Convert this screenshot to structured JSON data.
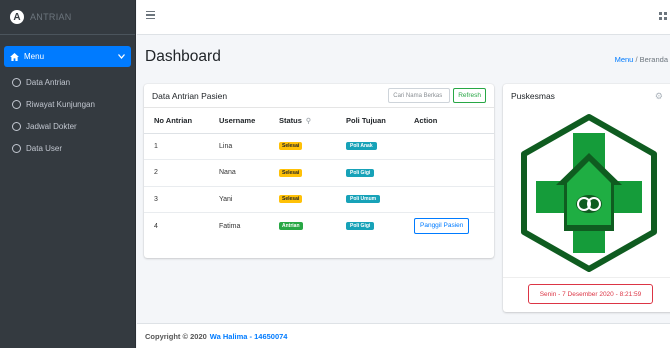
{
  "brand": {
    "name": "ANTRIAN"
  },
  "sidebar": {
    "menu_label": "Menu",
    "items": [
      {
        "label": "Data Antrian"
      },
      {
        "label": "Riwayat Kunjungan"
      },
      {
        "label": "Jadwal Dokter"
      },
      {
        "label": "Data User"
      }
    ]
  },
  "header": {
    "title": "Dashboard",
    "breadcrumb": {
      "first": "Menu",
      "sep": "/",
      "second": "Beranda"
    }
  },
  "queue_card": {
    "title": "Data Antrian Pasien",
    "search_placeholder": "Cari Nama Berkas",
    "refresh_label": "Refresh",
    "columns": [
      "No Antrian",
      "Username",
      "Status",
      "Poli Tujuan",
      "Action"
    ],
    "rows": [
      {
        "no": "1",
        "username": "Lina",
        "status": "Selesai",
        "poli": "Poli Anak",
        "action": ""
      },
      {
        "no": "2",
        "username": "Nana",
        "status": "Selesai",
        "poli": "Poli Gigi",
        "action": ""
      },
      {
        "no": "3",
        "username": "Yani",
        "status": "Selesai",
        "poli": "Poli Umum",
        "action": ""
      },
      {
        "no": "4",
        "username": "Fatima",
        "status": "Antrian",
        "poli": "Poli Gigi",
        "action": "Panggil Pasien"
      }
    ]
  },
  "puskesmas_card": {
    "title": "Puskesmas",
    "datetime": "Senin - 7 Desember 2020 - 8:21:59"
  },
  "footer": {
    "copyright": "Copyright © 2020",
    "author": "Wa Halima - 14650074"
  },
  "colors": {
    "sidebar": "#343a40",
    "accent": "#007bff",
    "status_done": "#ffc107",
    "status_queue": "#28a745",
    "poli": "#17a2b8",
    "logo_green": "#17a2b8",
    "danger": "#dc3545"
  },
  "icons": {
    "menu_home": "home-icon",
    "chevron": "chevron-down-icon",
    "toggle": "hamburger-icon",
    "apps": "grid-icon",
    "settings": "gear-icon",
    "sort": "search-icon"
  }
}
